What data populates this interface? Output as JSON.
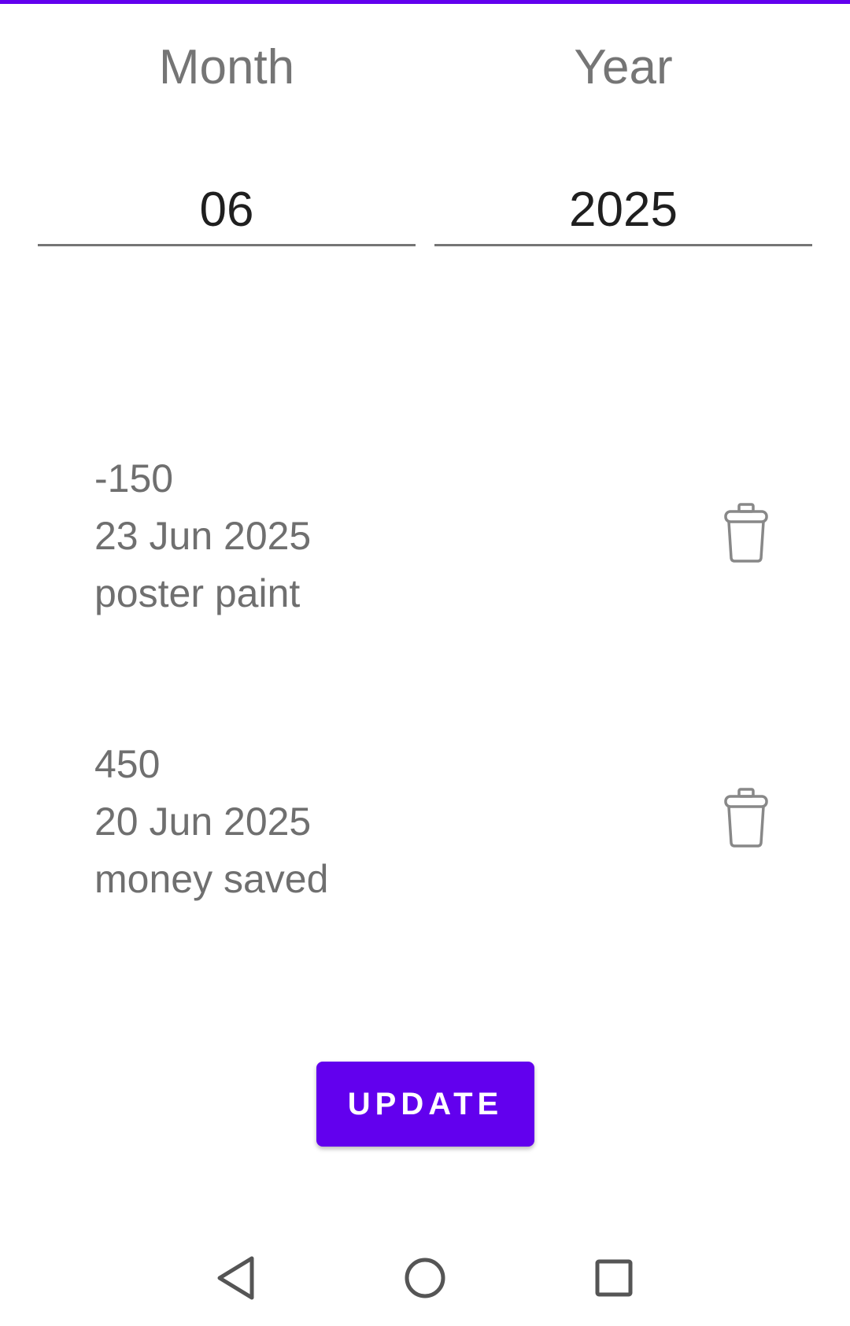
{
  "theme": {
    "accent": "#6200ee",
    "label_gray": "#757575",
    "text_gray": "#6f6f6f",
    "icon_gray": "#888888"
  },
  "header": {
    "month_label": "Month",
    "year_label": "Year"
  },
  "inputs": {
    "month_value": "06",
    "year_value": "2025"
  },
  "entries": [
    {
      "amount": "-150",
      "date": "23 Jun 2025",
      "description": "poster paint",
      "action_icon": "trash-icon"
    },
    {
      "amount": "450",
      "date": "20 Jun 2025",
      "description": "money saved",
      "action_icon": "trash-icon"
    }
  ],
  "actions": {
    "update_label": "UPDATE"
  },
  "navigation": {
    "back_icon": "back-triangle-icon",
    "home_icon": "home-circle-icon",
    "recents_icon": "recents-square-icon"
  }
}
